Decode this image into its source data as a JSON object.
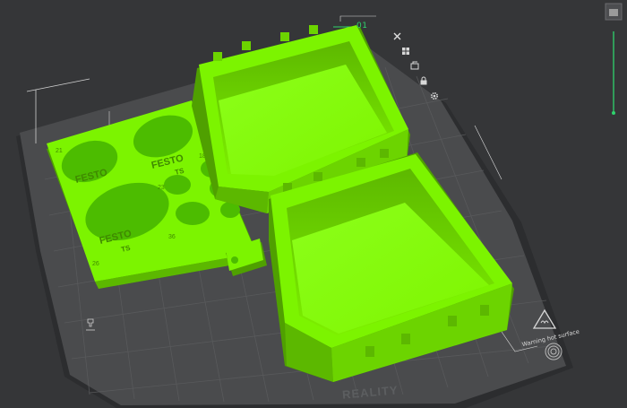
{
  "plate": {
    "label": "01",
    "brand": "REALITY",
    "warning": "Warning hot surface"
  },
  "tray_engravings": {
    "top_left": "FESTO",
    "top_right": "FESTO",
    "top_right_sub": "TS",
    "bottom": "FESTO",
    "bottom_sub": "TS",
    "num_left_bottom": "26",
    "num_mid": "23",
    "num_mid_bottom": "36",
    "num_right_top": "18",
    "num_top_left": "21"
  },
  "plate_tools": [
    {
      "id": "close",
      "icon": "close-icon"
    },
    {
      "id": "arrange",
      "icon": "arrange-icon"
    },
    {
      "id": "orient",
      "icon": "auto-orient-icon"
    },
    {
      "id": "lock",
      "icon": "lock-icon"
    },
    {
      "id": "settings",
      "icon": "gear-icon"
    }
  ],
  "colors": {
    "model": "#7cf400",
    "model_shadow": "#4fa000",
    "plate": "#4a4b4d",
    "plate_edge": "#2e2f31",
    "accent": "#2fd36d",
    "background": "#353638"
  },
  "layer_slider": {
    "level": 1.0
  }
}
